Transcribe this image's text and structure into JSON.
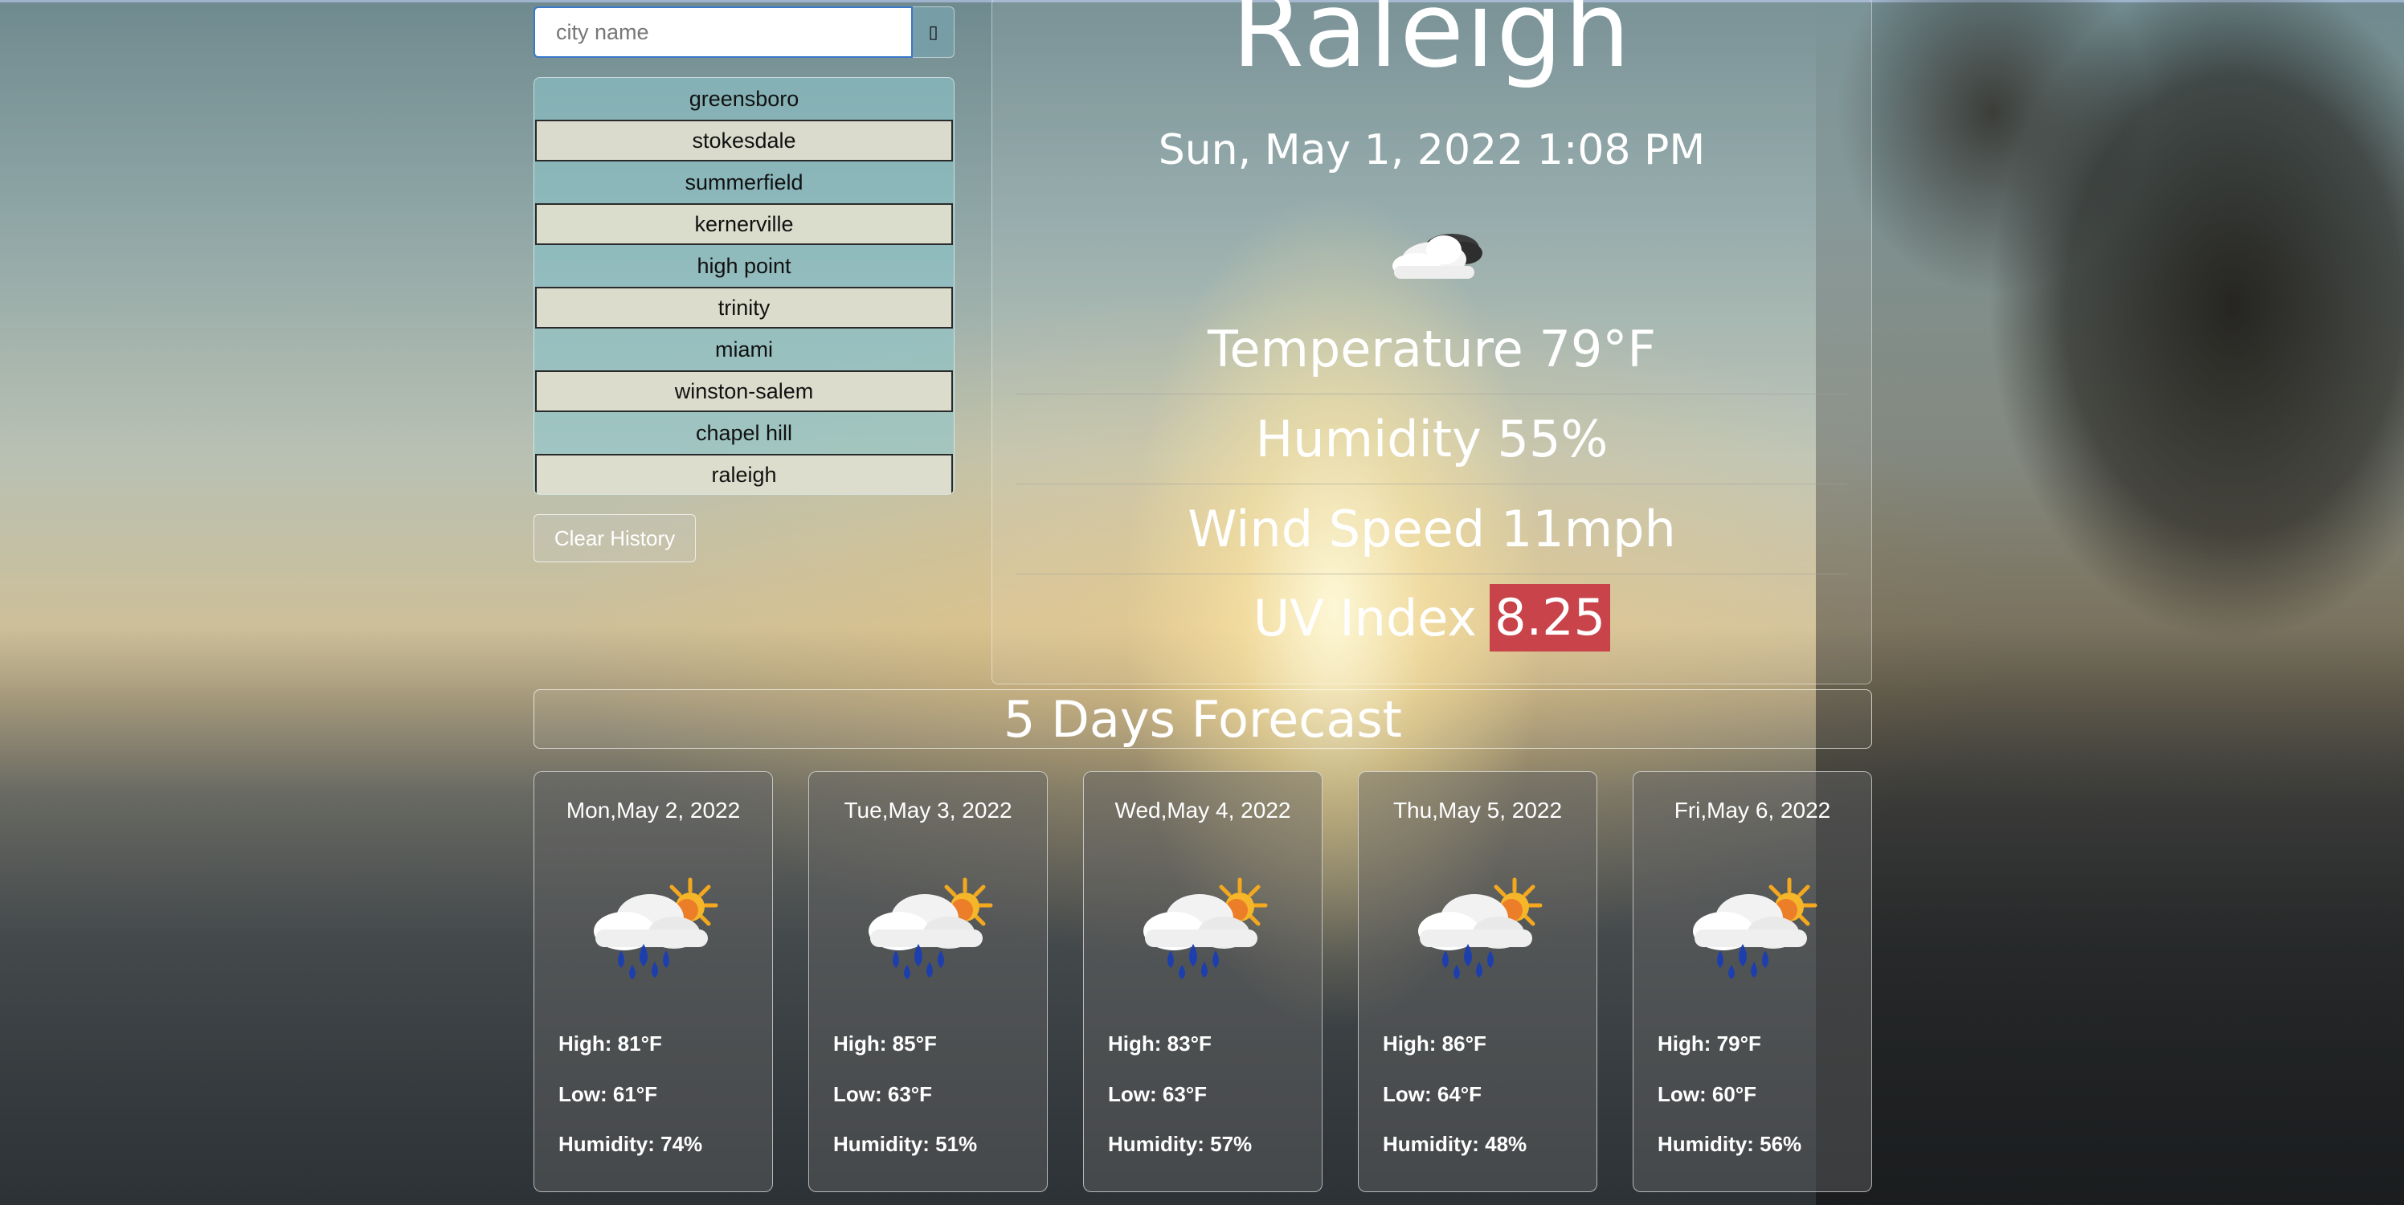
{
  "search": {
    "placeholder": "city name",
    "button_icon": "search-icon"
  },
  "history": {
    "items": [
      "greensboro",
      "stokesdale",
      "summerfield",
      "kernerville",
      "high point",
      "trinity",
      "miami",
      "winston-salem",
      "chapel hill",
      "raleigh"
    ],
    "clear_label": "Clear History"
  },
  "current": {
    "city": "Raleigh",
    "datetime": "Sun, May 1, 2022 1:08 PM",
    "icon": "cloud-icon",
    "temperature": "Temperature 79°F",
    "humidity": "Humidity 55%",
    "wind": "Wind Speed 11mph",
    "uv_label": "UV Index",
    "uv_value": "8.25",
    "uv_color": "#c8434a"
  },
  "forecast": {
    "title": "5 Days Forecast",
    "days": [
      {
        "date": "Mon,May 2, 2022",
        "icon": "rain-sun-icon",
        "high": "High: 81°F",
        "low": "Low: 61°F",
        "humidity": "Humidity: 74%"
      },
      {
        "date": "Tue,May 3, 2022",
        "icon": "rain-sun-icon",
        "high": "High: 85°F",
        "low": "Low: 63°F",
        "humidity": "Humidity: 51%"
      },
      {
        "date": "Wed,May 4, 2022",
        "icon": "rain-sun-icon",
        "high": "High: 83°F",
        "low": "Low: 63°F",
        "humidity": "Humidity: 57%"
      },
      {
        "date": "Thu,May 5, 2022",
        "icon": "rain-sun-icon",
        "high": "High: 86°F",
        "low": "Low: 64°F",
        "humidity": "Humidity: 48%"
      },
      {
        "date": "Fri,May 6, 2022",
        "icon": "rain-sun-icon",
        "high": "High: 79°F",
        "low": "Low: 60°F",
        "humidity": "Humidity: 56%"
      }
    ]
  }
}
